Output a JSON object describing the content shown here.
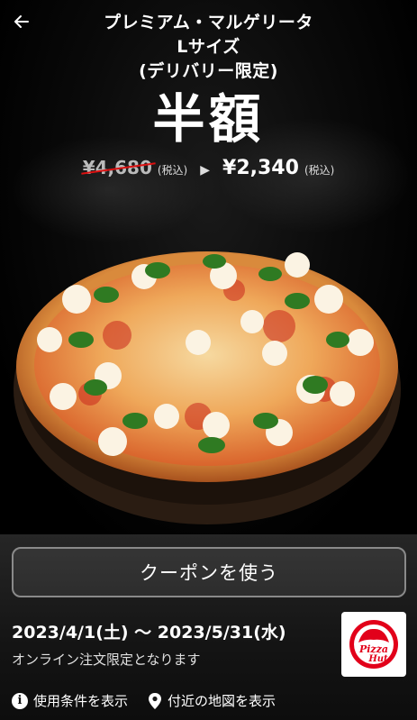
{
  "header": {
    "back_icon": "arrow-left-icon",
    "title_lines": [
      "プレミアム・マルゲリータ",
      "Lサイズ",
      "(デリバリー限定)"
    ]
  },
  "promo": {
    "headline": "半額",
    "old_price": "¥4,680",
    "old_tax": "(税込)",
    "arrow": "▶",
    "new_price": "¥2,340",
    "new_tax": "(税込)"
  },
  "coupon": {
    "button_label": "クーポンを使う",
    "date_range": "2023/4/1(土) 〜 2023/5/31(水)",
    "note": "オンライン注文限定となります",
    "logo_text_1": "Pizza",
    "logo_text_2": "Hut"
  },
  "links": {
    "terms_label": "使用条件を表示",
    "map_label": "付近の地図を表示",
    "terms_icon": "info-icon",
    "map_icon": "location-pin-icon"
  },
  "colors": {
    "background": "#000000",
    "strike_red": "#dd1111",
    "brand_red": "#e2001a"
  }
}
